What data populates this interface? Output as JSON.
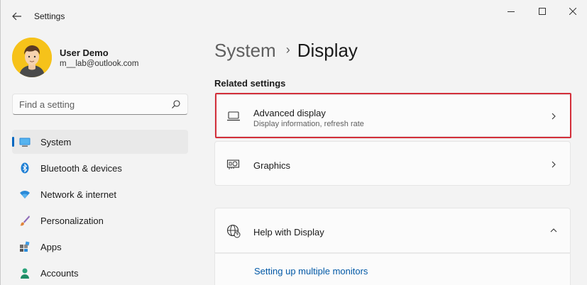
{
  "window": {
    "title": "Settings"
  },
  "user": {
    "name": "User Demo",
    "email": "m__lab@outlook.com"
  },
  "search": {
    "placeholder": "Find a setting"
  },
  "sidebar": {
    "items": [
      {
        "label": "System",
        "icon": "monitor-icon",
        "active": true
      },
      {
        "label": "Bluetooth & devices",
        "icon": "bluetooth-icon",
        "active": false
      },
      {
        "label": "Network & internet",
        "icon": "wifi-icon",
        "active": false
      },
      {
        "label": "Personalization",
        "icon": "brush-icon",
        "active": false
      },
      {
        "label": "Apps",
        "icon": "apps-icon",
        "active": false
      },
      {
        "label": "Accounts",
        "icon": "person-icon",
        "active": false
      }
    ]
  },
  "breadcrumb": {
    "parent": "System",
    "separator": "›",
    "current": "Display"
  },
  "related": {
    "heading": "Related settings",
    "items": [
      {
        "title": "Advanced display",
        "subtitle": "Display information, refresh rate",
        "icon": "laptop-icon",
        "highlighted": true
      },
      {
        "title": "Graphics",
        "subtitle": "",
        "icon": "graphics-card-icon",
        "highlighted": false
      }
    ]
  },
  "help": {
    "title": "Help with Display",
    "icon": "globe-help-icon",
    "expanded": true,
    "links": [
      {
        "label": "Setting up multiple monitors"
      }
    ]
  },
  "colors": {
    "accent": "#0067c0",
    "highlight": "#d32f3a",
    "link": "#0058a6"
  }
}
